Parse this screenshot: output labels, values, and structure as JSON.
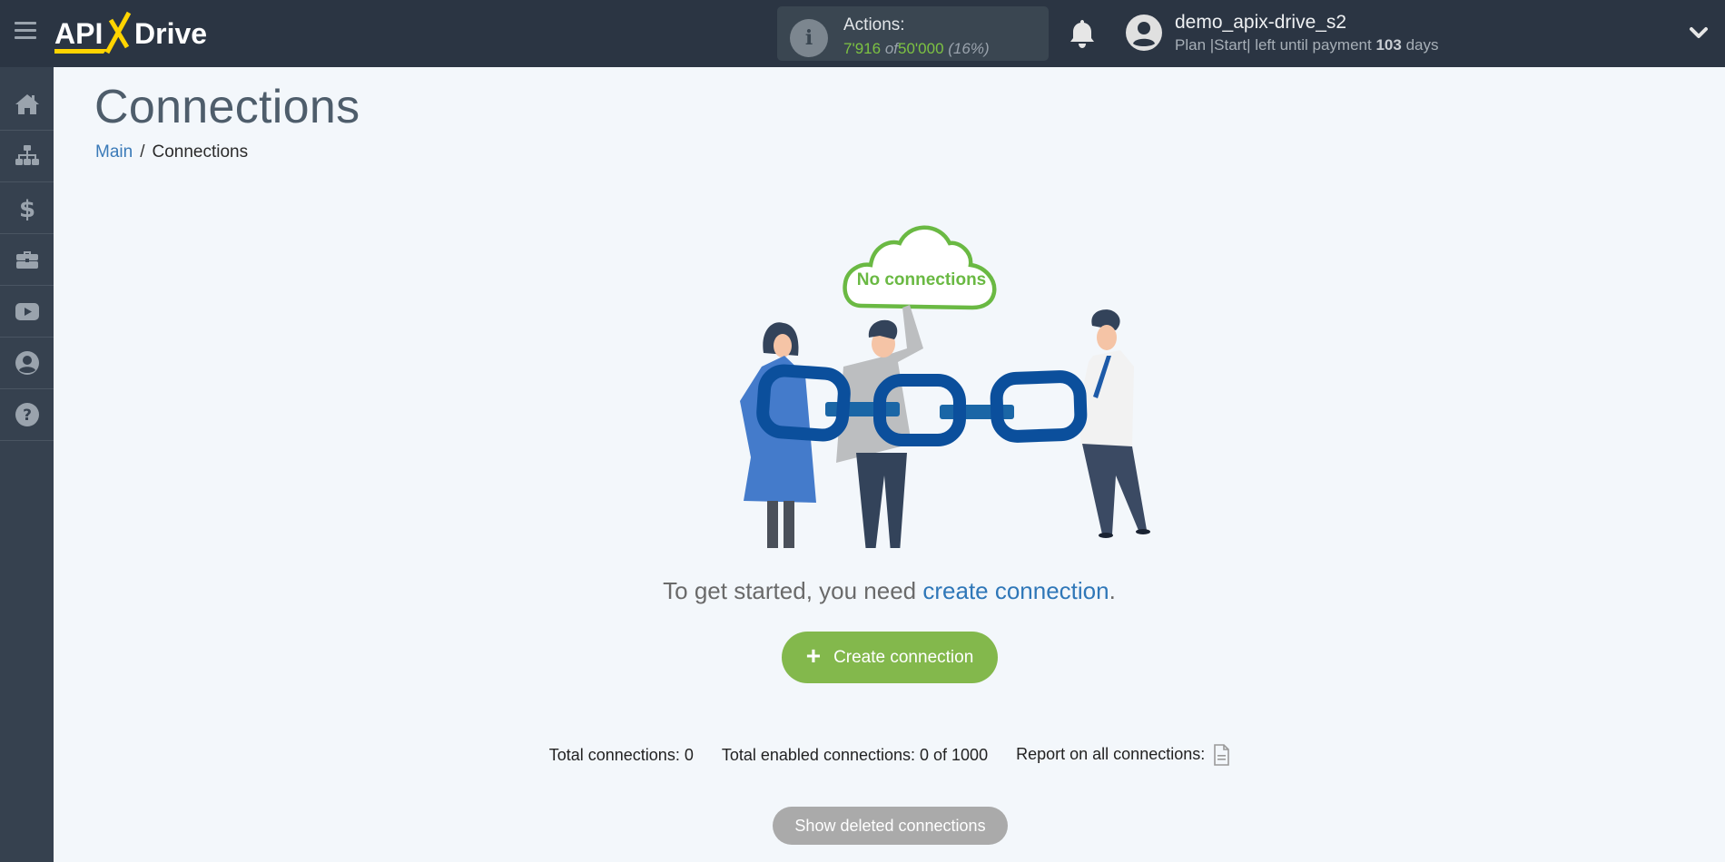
{
  "header": {
    "logo": {
      "part1": "API",
      "part2": "X",
      "part3": "Drive"
    },
    "actions": {
      "label": "Actions:",
      "used": "7'916",
      "of": "of",
      "total": "50'000",
      "percent": "(16%)",
      "progress_fraction": 0.16
    },
    "user": {
      "name": "demo_apix-drive_s2",
      "plan_prefix": "Plan |Start| left until payment",
      "days": "103",
      "days_suffix": "days"
    }
  },
  "sidebar": {
    "items": [
      {
        "name": "home",
        "icon": "home-icon"
      },
      {
        "name": "connections",
        "icon": "sitemap-icon"
      },
      {
        "name": "billing",
        "icon": "dollar-icon"
      },
      {
        "name": "tools",
        "icon": "briefcase-icon"
      },
      {
        "name": "video",
        "icon": "youtube-icon"
      },
      {
        "name": "profile",
        "icon": "user-circle-icon"
      },
      {
        "name": "help",
        "icon": "question-circle-icon"
      }
    ]
  },
  "page": {
    "title": "Connections",
    "breadcrumb": {
      "home": "Main",
      "separator": "/",
      "current": "Connections"
    },
    "illustration_caption": "No connections",
    "started_text": "To get started, you need ",
    "started_link": "create connection",
    "started_end": ".",
    "create_button": "Create connection",
    "stats": {
      "total": "Total connections: 0",
      "enabled": "Total enabled connections: 0 of 1000",
      "report": "Report on all connections:"
    },
    "show_deleted_button": "Show deleted connections"
  },
  "colors": {
    "topbar": "#2b3543",
    "sidebar": "#36414f",
    "accent_green": "#83b84c",
    "link_blue": "#2f77b8",
    "logo_yellow": "#ffd400"
  }
}
